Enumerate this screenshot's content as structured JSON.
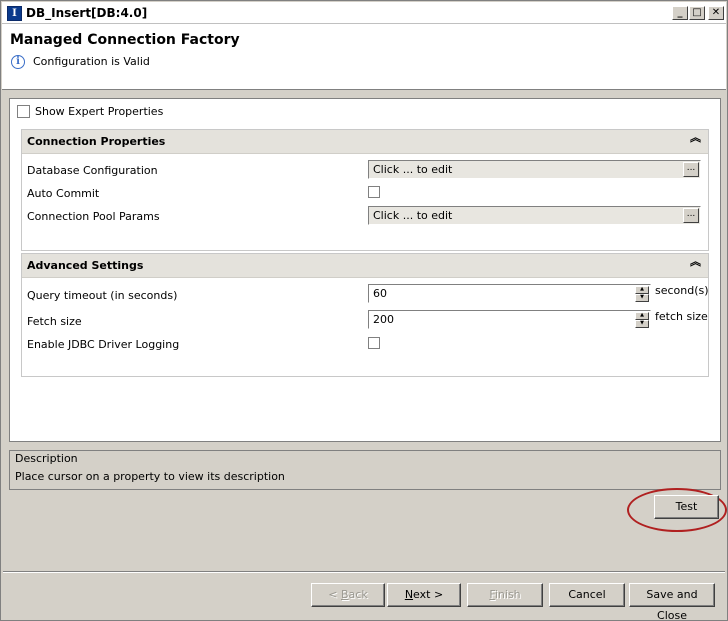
{
  "window": {
    "title": "DB_Insert[DB:4.0]",
    "app_icon": "app-icon",
    "minimize": "_",
    "maximize": "□",
    "close": "✕"
  },
  "header": {
    "heading": "Managed Connection Factory",
    "info_icon": "i",
    "status": "Configuration is Valid"
  },
  "form": {
    "show_expert_label": "Show Expert Properties",
    "show_expert_checked": false,
    "connection": {
      "title": "Connection Properties",
      "collapse_glyph": "⌃⌃",
      "rows": [
        {
          "label": "Database Configuration",
          "value": "Click ... to edit",
          "button": "..."
        },
        {
          "label": "Auto Commit",
          "checked": false
        },
        {
          "label": "Connection Pool Params",
          "value": "Click ... to edit",
          "button": "..."
        }
      ]
    },
    "advanced": {
      "title": "Advanced Settings",
      "collapse_glyph": "⌃⌃",
      "rows": [
        {
          "label": "Query timeout (in seconds)",
          "value": "60",
          "unit": "second(s)"
        },
        {
          "label": "Fetch size",
          "value": "200",
          "unit": "fetch size"
        },
        {
          "label": "Enable JDBC Driver Logging",
          "checked": false
        }
      ]
    }
  },
  "description": {
    "title": "Description",
    "text": "Place cursor on a property to view its description"
  },
  "buttons": {
    "test": "Test",
    "back_prefix": "< ",
    "back_ul": "B",
    "back_rest": "ack",
    "next_ul": "N",
    "next_rest": "ext >",
    "finish_ul": "F",
    "finish_rest": "inish",
    "cancel": "Cancel",
    "save_close": "Save and Close"
  },
  "colors": {
    "highlight_ring": "#b02020",
    "dialog_bg": "#d4d0c8"
  }
}
